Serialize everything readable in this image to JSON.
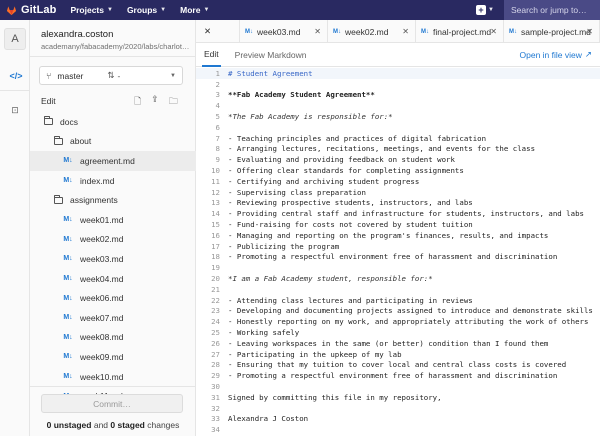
{
  "navbar": {
    "brand": "GitLab",
    "menus": [
      "Projects",
      "Groups",
      "More"
    ],
    "search_placeholder": "Search or jump to…"
  },
  "rail": {
    "avatar_letter": "A"
  },
  "project": {
    "name": "alexandra.coston",
    "path": "academany/fabacademy/2020/labs/charlotte/s..."
  },
  "branch": {
    "name": "master",
    "mr": "-"
  },
  "tree": {
    "edit_label": "Edit",
    "items": [
      {
        "label": "docs",
        "type": "folder",
        "depth": 0
      },
      {
        "label": "about",
        "type": "folder",
        "depth": 1
      },
      {
        "label": "agreement.md",
        "type": "file",
        "depth": 2,
        "active": true
      },
      {
        "label": "index.md",
        "type": "file",
        "depth": 2
      },
      {
        "label": "assignments",
        "type": "folder",
        "depth": 1
      },
      {
        "label": "week01.md",
        "type": "file",
        "depth": 2
      },
      {
        "label": "week02.md",
        "type": "file",
        "depth": 2
      },
      {
        "label": "week03.md",
        "type": "file",
        "depth": 2
      },
      {
        "label": "week04.md",
        "type": "file",
        "depth": 2
      },
      {
        "label": "week06.md",
        "type": "file",
        "depth": 2
      },
      {
        "label": "week07.md",
        "type": "file",
        "depth": 2
      },
      {
        "label": "week08.md",
        "type": "file",
        "depth": 2
      },
      {
        "label": "week09.md",
        "type": "file",
        "depth": 2
      },
      {
        "label": "week10.md",
        "type": "file",
        "depth": 2
      },
      {
        "label": "week11.md",
        "type": "file",
        "depth": 2
      }
    ],
    "commit_label": "Commit…",
    "changes": {
      "unstaged": "0 unstaged",
      "and": " and ",
      "staged": "0 staged",
      "suffix": " changes"
    }
  },
  "tabs": [
    {
      "label": "week03.md"
    },
    {
      "label": "week02.md"
    },
    {
      "label": "final-project.md"
    },
    {
      "label": "sample-project.md"
    }
  ],
  "editor": {
    "mode_edit": "Edit",
    "mode_preview": "Preview Markdown",
    "open_in_file_view": "Open in file view",
    "lines": [
      {
        "n": "1",
        "text": "# Student Agreement",
        "style": "heading",
        "cur": true
      },
      {
        "n": "2",
        "text": "",
        "style": ""
      },
      {
        "n": "3",
        "text": "**Fab Academy Student Agreement**",
        "style": "bold"
      },
      {
        "n": "4",
        "text": "",
        "style": ""
      },
      {
        "n": "5",
        "text": "*The Fab Academy is responsible for:*",
        "style": "ital"
      },
      {
        "n": "6",
        "text": "",
        "style": ""
      },
      {
        "n": "7",
        "text": "- Teaching principles and practices of digital fabrication",
        "style": ""
      },
      {
        "n": "8",
        "text": "- Arranging lectures, recitations, meetings, and events for the class",
        "style": ""
      },
      {
        "n": "9",
        "text": "- Evaluating and providing feedback on student work",
        "style": ""
      },
      {
        "n": "10",
        "text": "- Offering clear standards for completing assignments",
        "style": ""
      },
      {
        "n": "11",
        "text": "- Certifying and archiving student progress",
        "style": ""
      },
      {
        "n": "12",
        "text": "- Supervising class preparation",
        "style": ""
      },
      {
        "n": "13",
        "text": "- Reviewing prospective students, instructors, and labs",
        "style": ""
      },
      {
        "n": "14",
        "text": "- Providing central staff and infrastructure for students, instructors, and labs",
        "style": ""
      },
      {
        "n": "15",
        "text": "- Fund-raising for costs not covered by student tuition",
        "style": ""
      },
      {
        "n": "16",
        "text": "- Managing and reporting on the program's finances, results, and impacts",
        "style": ""
      },
      {
        "n": "17",
        "text": "- Publicizing the program",
        "style": ""
      },
      {
        "n": "18",
        "text": "- Promoting a respectful environment free of harassment and discrimination",
        "style": ""
      },
      {
        "n": "19",
        "text": "",
        "style": ""
      },
      {
        "n": "20",
        "text": "*I am a Fab Academy student, responsible for:*",
        "style": "ital"
      },
      {
        "n": "21",
        "text": "",
        "style": ""
      },
      {
        "n": "22",
        "text": "- Attending class lectures and participating in reviews",
        "style": ""
      },
      {
        "n": "23",
        "text": "- Developing and documenting projects assigned to introduce and demonstrate skills",
        "style": ""
      },
      {
        "n": "24",
        "text": "- Honestly reporting on my work, and appropriately attributing the work of others",
        "style": ""
      },
      {
        "n": "25",
        "text": "- Working safely",
        "style": ""
      },
      {
        "n": "26",
        "text": "- Leaving workspaces in the same (or better) condition than I found them",
        "style": ""
      },
      {
        "n": "27",
        "text": "- Participating in the upkeep of my lab",
        "style": ""
      },
      {
        "n": "28",
        "text": "- Ensuring that my tuition to cover local and central class costs is covered",
        "style": ""
      },
      {
        "n": "29",
        "text": "- Promoting a respectful environment free of harassment and discrimination",
        "style": ""
      },
      {
        "n": "30",
        "text": "",
        "style": ""
      },
      {
        "n": "31",
        "text": "Signed by committing this file in my repository,",
        "style": ""
      },
      {
        "n": "32",
        "text": "",
        "style": ""
      },
      {
        "n": "33",
        "text": "Alexandra J Coston",
        "style": ""
      },
      {
        "n": "34",
        "text": "",
        "style": ""
      }
    ]
  }
}
